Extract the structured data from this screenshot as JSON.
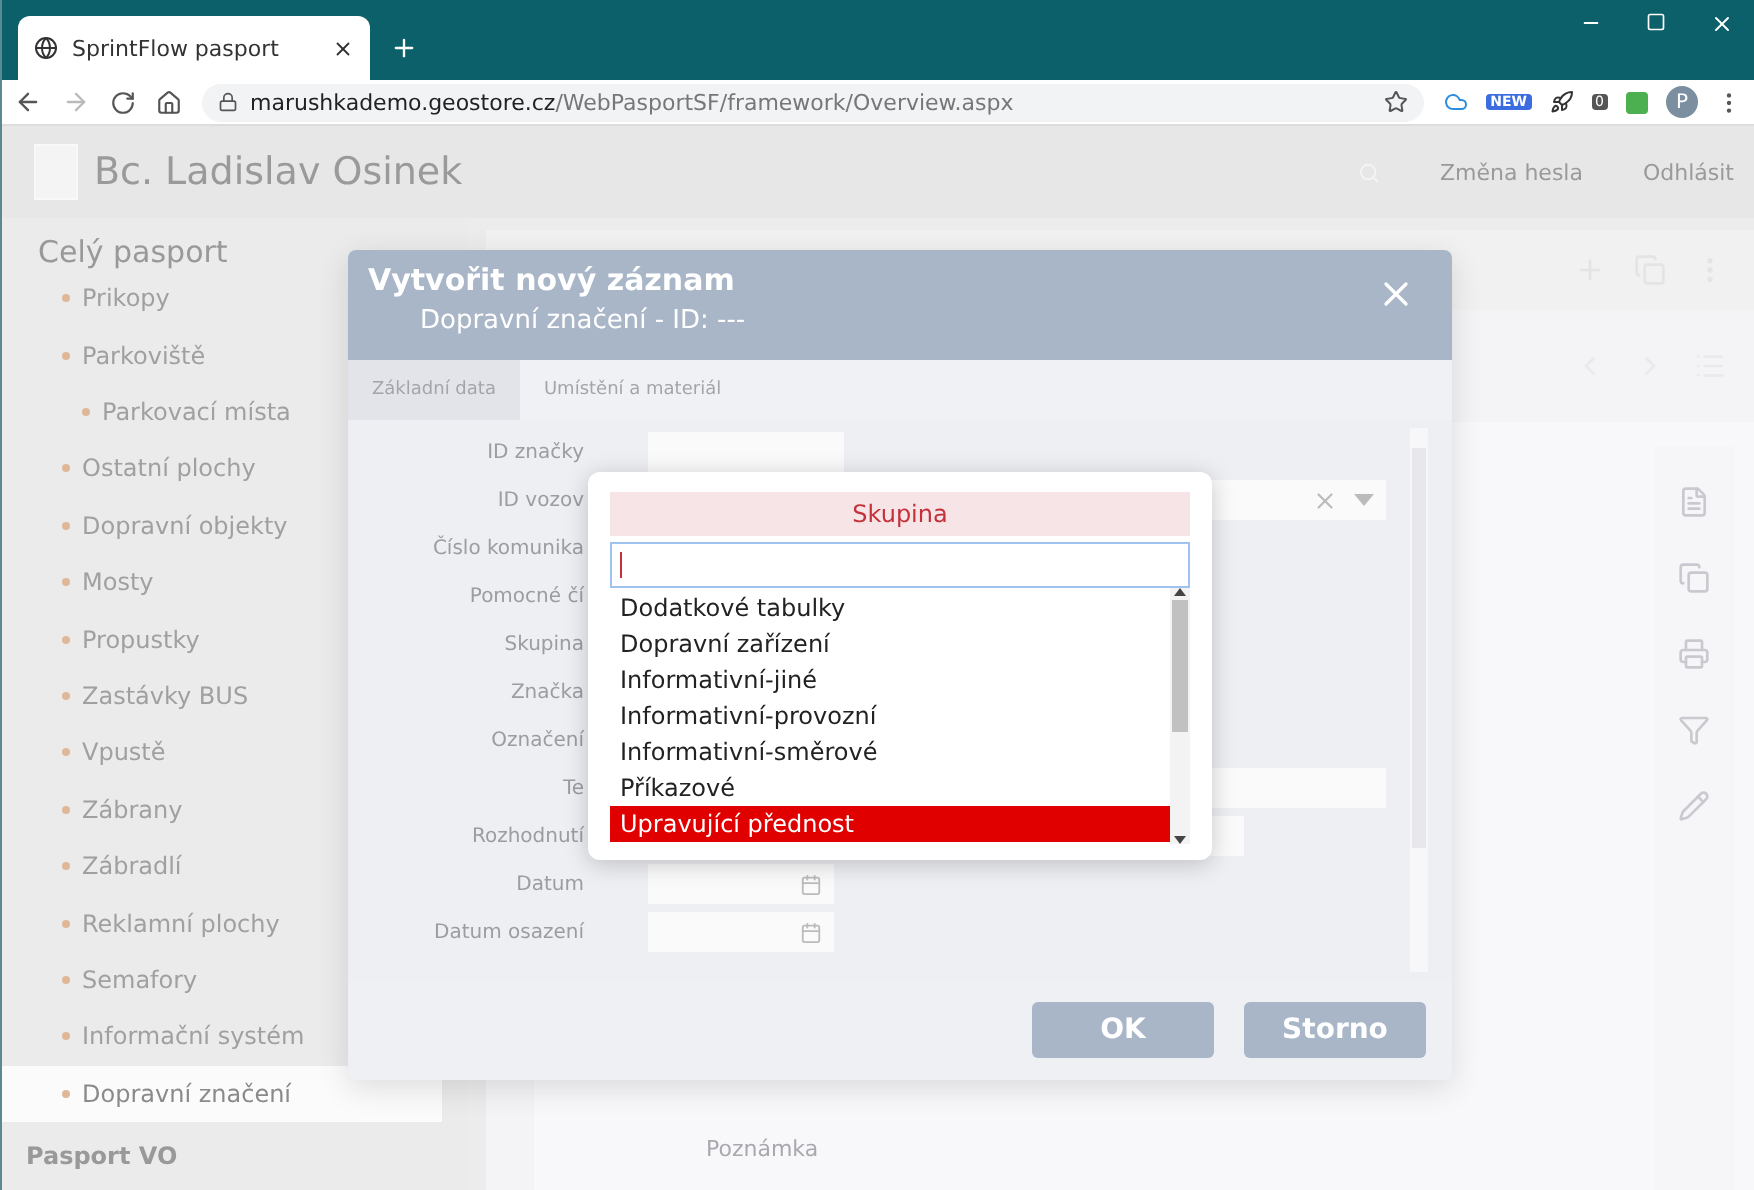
{
  "browser": {
    "tab_title": "SprintFlow pasport",
    "url_host": "marushkademo.geostore.cz",
    "url_path": "/WebPasportSF/framework/Overview.aspx",
    "extension_badge_new": "NEW",
    "extension_badge_count": "0",
    "profile_initial": "P"
  },
  "header": {
    "user_name": "Bc. Ladislav Osinek",
    "links": [
      "Změna hesla",
      "Odhlásit"
    ]
  },
  "sidebar": {
    "section": "Celý pasport",
    "items": [
      {
        "label": "Prikopy",
        "selected": false
      },
      {
        "label": "Parkoviště",
        "selected": false,
        "children": [
          {
            "label": "Parkovací místa",
            "selected": false
          }
        ]
      },
      {
        "label": "Ostatní plochy",
        "selected": false
      },
      {
        "label": "Dopravní objekty",
        "selected": false
      },
      {
        "label": "Mosty",
        "selected": false
      },
      {
        "label": "Propustky",
        "selected": false
      },
      {
        "label": "Zastávky BUS",
        "selected": false
      },
      {
        "label": "Vpustě",
        "selected": false
      },
      {
        "label": "Zábrany",
        "selected": false
      },
      {
        "label": "Zábradlí",
        "selected": false
      },
      {
        "label": "Reklamní plochy",
        "selected": false
      },
      {
        "label": "Semafory",
        "selected": false
      },
      {
        "label": "Informační systém",
        "selected": false
      },
      {
        "label": "Dopravní značení",
        "selected": true
      }
    ],
    "section_2": "Pasport VO"
  },
  "main": {
    "note_label": "Poznámka"
  },
  "modal": {
    "title": "Vytvořit nový záznam",
    "subtitle": "Dopravní značení - ID: ---",
    "tabs": [
      {
        "label": "Základní data",
        "selected": true
      },
      {
        "label": "Umístění a materiál",
        "selected": false
      }
    ],
    "fields": [
      {
        "label": "ID značky",
        "kind": "short"
      },
      {
        "label": "ID vozov",
        "kind": "select"
      },
      {
        "label": "Číslo komunika",
        "kind": "short"
      },
      {
        "label": "Pomocné čí",
        "kind": "short"
      },
      {
        "label": "Skupina",
        "kind": "short"
      },
      {
        "label": "Značka",
        "kind": "short"
      },
      {
        "label": "Označení",
        "kind": "short"
      },
      {
        "label": "Te",
        "kind": "long"
      },
      {
        "label": "Rozhodnutí",
        "kind": "medium"
      },
      {
        "label": "Datum",
        "kind": "date"
      },
      {
        "label": "Datum osazení",
        "kind": "date"
      }
    ],
    "buttons": [
      "OK",
      "Storno"
    ]
  },
  "dropdown": {
    "title": "Skupina",
    "options": [
      {
        "label": "Dodatkové tabulky",
        "selected": false
      },
      {
        "label": "Dopravní zařízení",
        "selected": false
      },
      {
        "label": "Informativní-jiné",
        "selected": false
      },
      {
        "label": "Informativní-provozní",
        "selected": false
      },
      {
        "label": "Informativní-směrové",
        "selected": false
      },
      {
        "label": "Příkazové",
        "selected": false
      },
      {
        "label": "Upravující přednost",
        "selected": true
      }
    ]
  }
}
